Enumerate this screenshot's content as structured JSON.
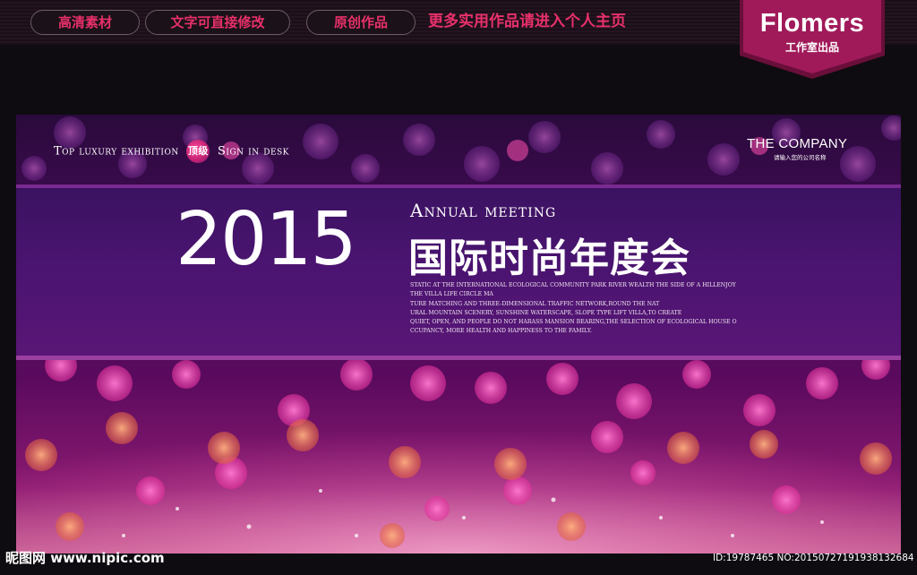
{
  "top_bar": {
    "tags": [
      "高清素材",
      "文字可直接修改",
      "原创作品"
    ],
    "promo": "更多实用作品请进入个人主页"
  },
  "brand": {
    "name": "Flomers",
    "subtitle": "工作室出品"
  },
  "banner": {
    "top_line_pre": "Top luxury exhibition",
    "badge": "顶级",
    "top_line_post": "Sign in desk",
    "company": "THE COMPANY",
    "company_sub": "请输入您的公司名称",
    "year": "2015",
    "annual": "Annual meeting",
    "title_cn": "国际时尚年度会",
    "paragraph": [
      "STATIC AT THE INTERNATIONAL ECOLOGICAL COMMUNITY PARK RIVER WEALTH THE SIDE OF A HILLENJOY",
      "THE VILLA LIFE CIRCLE MA",
      "TURE MATCHING AND THREE-DIMENSIONAL TRAFFIC NETWORK,ROUND THE NAT",
      "URAL MOUNTAIN SCENERY, SUNSHINE WATERSCAPE, SLOPE TYPE LIFT VILLA,TO CREATE",
      "QUIET, OPEN, AND PEOPLE DO NOT HARASS MANSION BEARING,THE SELECTION OF ECOLOGICAL HOUSE O",
      "CCUPANCY, MORE HEALTH AND HAPPINESS TO THE FAMILY."
    ]
  },
  "watermark": {
    "left": "昵图网 www.nipic.com",
    "right": "ID:19787465 NO:20150727191938132684"
  },
  "colors": {
    "accent_pink": "#e8306a",
    "brand_bg": "#a01a5a"
  }
}
